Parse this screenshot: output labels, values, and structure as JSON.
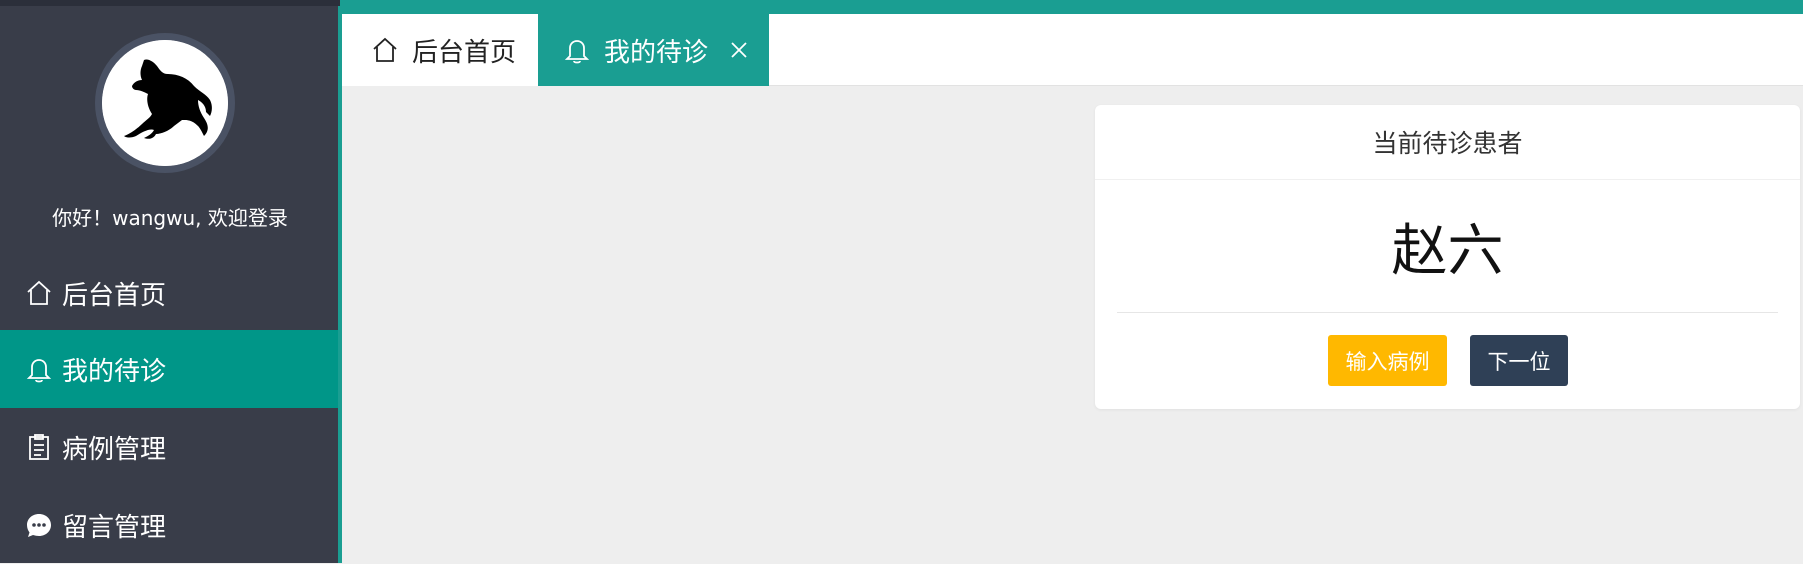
{
  "sidebar": {
    "avatar_icon": "horse-logo",
    "welcome_text": "你好！wangwu, 欢迎登录",
    "items": [
      {
        "label": "后台首页",
        "icon": "home-icon"
      },
      {
        "label": "我的待诊",
        "icon": "bell-icon",
        "active": true
      },
      {
        "label": "病例管理",
        "icon": "clipboard-icon"
      },
      {
        "label": "留言管理",
        "icon": "chat-icon"
      }
    ]
  },
  "tabs": {
    "home_label": "后台首页",
    "active_label": "我的待诊"
  },
  "card": {
    "title": "当前待诊患者",
    "patient_name": "赵六",
    "enter_case_label": "输入病例",
    "next_label": "下一位"
  },
  "colors": {
    "sidebar_bg": "#393d49",
    "accent": "#009688",
    "tab_active": "#1a9e92",
    "btn_yellow": "#ffb800",
    "btn_dark": "#2f4056"
  }
}
